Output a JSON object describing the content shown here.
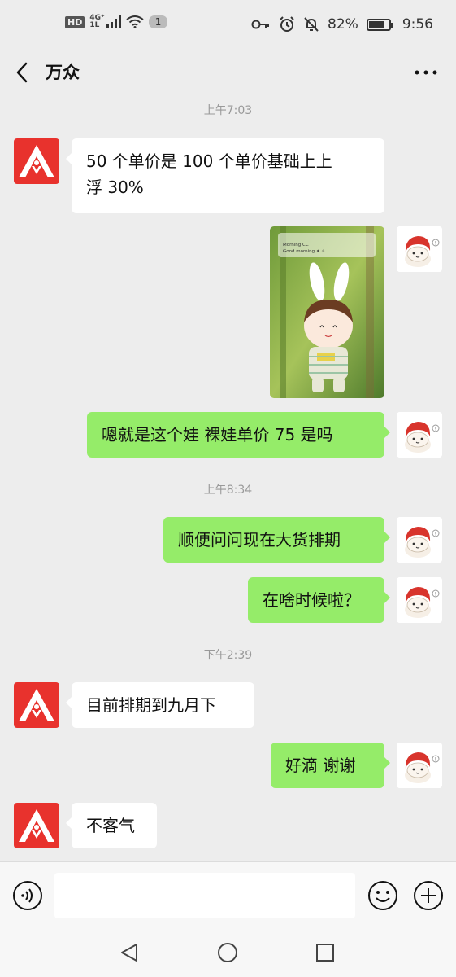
{
  "status_bar": {
    "hd": "HD",
    "net_top": "4G⁺",
    "net_bottom": "1L",
    "sim": "1",
    "battery": "82%",
    "time": "9:56",
    "icons": [
      "key-icon",
      "alarm-icon",
      "bell-off-icon",
      "battery-icon"
    ]
  },
  "header": {
    "title": "万众",
    "back_icon": "chevron-left-icon",
    "more_icon": "more-dots-icon"
  },
  "messages": {
    "t1": "上午7:03",
    "m1": "50 个单价是 100 个单价基础上上",
    "m1b": "浮 30%",
    "m3": "嗯就是这个娃  裸娃单价 75 是吗",
    "t2": "上午8:34",
    "m4": "顺便问问现在大货排期",
    "m5": "在啥时候啦？",
    "t3": "下午2:39",
    "m6": "目前排期到九月下",
    "m7": "好滴  谢谢",
    "m8": "不客气"
  },
  "photo": {
    "caption_top": "Morning CC",
    "caption_bottom": "Good morning ✦ ✧"
  },
  "input_bar": {
    "placeholder": "",
    "icons": [
      "voice-icon",
      "emoji-icon",
      "plus-icon"
    ]
  },
  "colors": {
    "background": "#ededed",
    "incoming_bubble": "#ffffff",
    "outgoing_bubble": "#95ec69",
    "brand_red": "#e8322d"
  }
}
